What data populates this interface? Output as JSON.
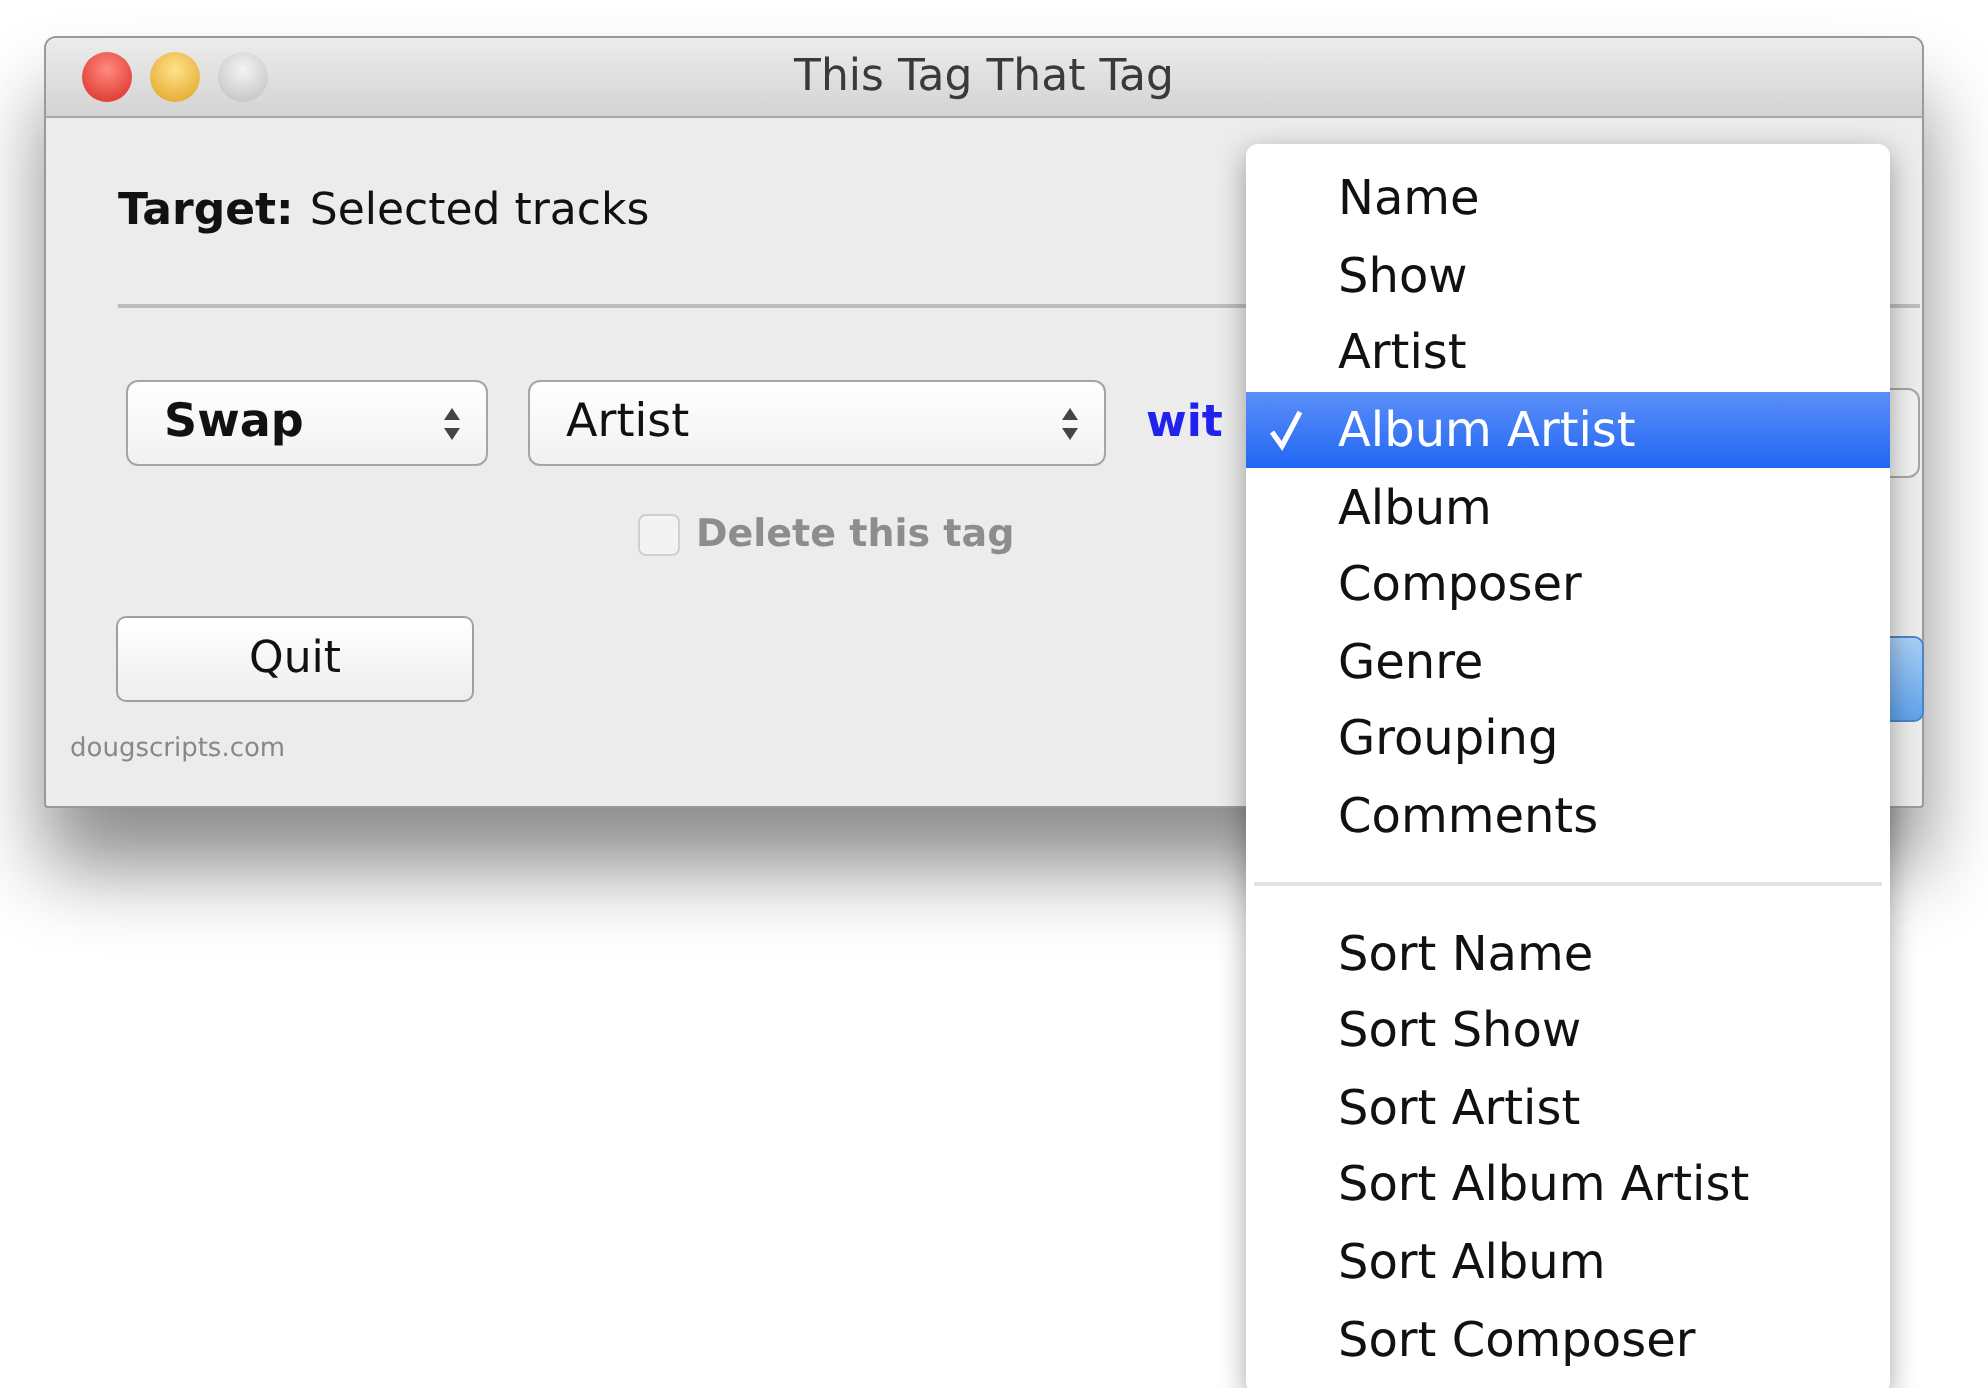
{
  "window": {
    "title": "This Tag That Tag"
  },
  "target": {
    "label": "Target:",
    "value": "Selected tracks"
  },
  "action_select": {
    "value": "Swap"
  },
  "tag_select": {
    "value": "Artist"
  },
  "with_label": "wit",
  "delete_checkbox": {
    "label": "Delete this tag",
    "checked": false,
    "disabled": true
  },
  "quit_button": "Quit",
  "footer": "dougscripts.com",
  "menu": {
    "sections": [
      {
        "items": [
          {
            "label": "Name",
            "selected": false
          },
          {
            "label": "Show",
            "selected": false
          },
          {
            "label": "Artist",
            "selected": false
          },
          {
            "label": "Album Artist",
            "selected": true
          },
          {
            "label": "Album",
            "selected": false
          },
          {
            "label": "Composer",
            "selected": false
          },
          {
            "label": "Genre",
            "selected": false
          },
          {
            "label": "Grouping",
            "selected": false
          },
          {
            "label": "Comments",
            "selected": false
          }
        ]
      },
      {
        "items": [
          {
            "label": "Sort Name",
            "selected": false
          },
          {
            "label": "Sort Show",
            "selected": false
          },
          {
            "label": "Sort Artist",
            "selected": false
          },
          {
            "label": "Sort Album Artist",
            "selected": false
          },
          {
            "label": "Sort Album",
            "selected": false
          },
          {
            "label": "Sort Composer",
            "selected": false
          }
        ]
      }
    ]
  }
}
